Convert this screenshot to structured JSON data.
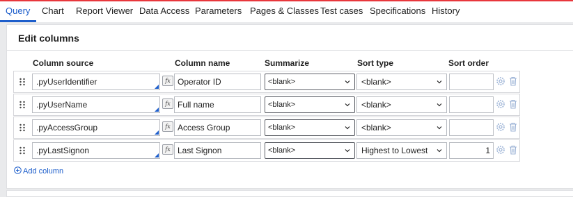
{
  "colors": {
    "accent": "#1d5ecb",
    "top_line": "#e8373c",
    "icon_muted": "#9cb3d6"
  },
  "tabs": [
    {
      "label": "Query",
      "active": true
    },
    {
      "label": "Chart"
    },
    {
      "label": "Report Viewer"
    },
    {
      "label": "Data Access"
    },
    {
      "label": "Parameters"
    },
    {
      "label": "Pages & Classes"
    },
    {
      "label": "Test cases"
    },
    {
      "label": "Specifications"
    },
    {
      "label": "History"
    }
  ],
  "panel": {
    "title": "Edit columns"
  },
  "columns": {
    "source": "Column source",
    "name": "Column name",
    "summarize": "Summarize",
    "sort_type": "Sort type",
    "sort_order": "Sort order"
  },
  "rows": [
    {
      "source": ".pyUserIdentifier",
      "fx": "fx",
      "name": "Operator ID",
      "summarize": "<blank>",
      "sort_type": "<blank>",
      "sort_order": ""
    },
    {
      "source": ".pyUserName",
      "fx": "fx",
      "name": "Full name",
      "summarize": "<blank>",
      "sort_type": "<blank>",
      "sort_order": ""
    },
    {
      "source": ".pyAccessGroup",
      "fx": "fx",
      "name": "Access Group",
      "summarize": "<blank>",
      "sort_type": "<blank>",
      "sort_order": ""
    },
    {
      "source": ".pyLastSignon",
      "fx": "fx",
      "name": "Last Signon",
      "summarize": "<blank>",
      "sort_type": "Highest to Lowest",
      "sort_order": "1"
    }
  ],
  "add_column": {
    "label": "Add column"
  },
  "icons": [
    "drag-handle-icon",
    "formula-icon",
    "chevron-down-icon",
    "gear-icon",
    "trash-icon",
    "plus-circle-icon"
  ]
}
